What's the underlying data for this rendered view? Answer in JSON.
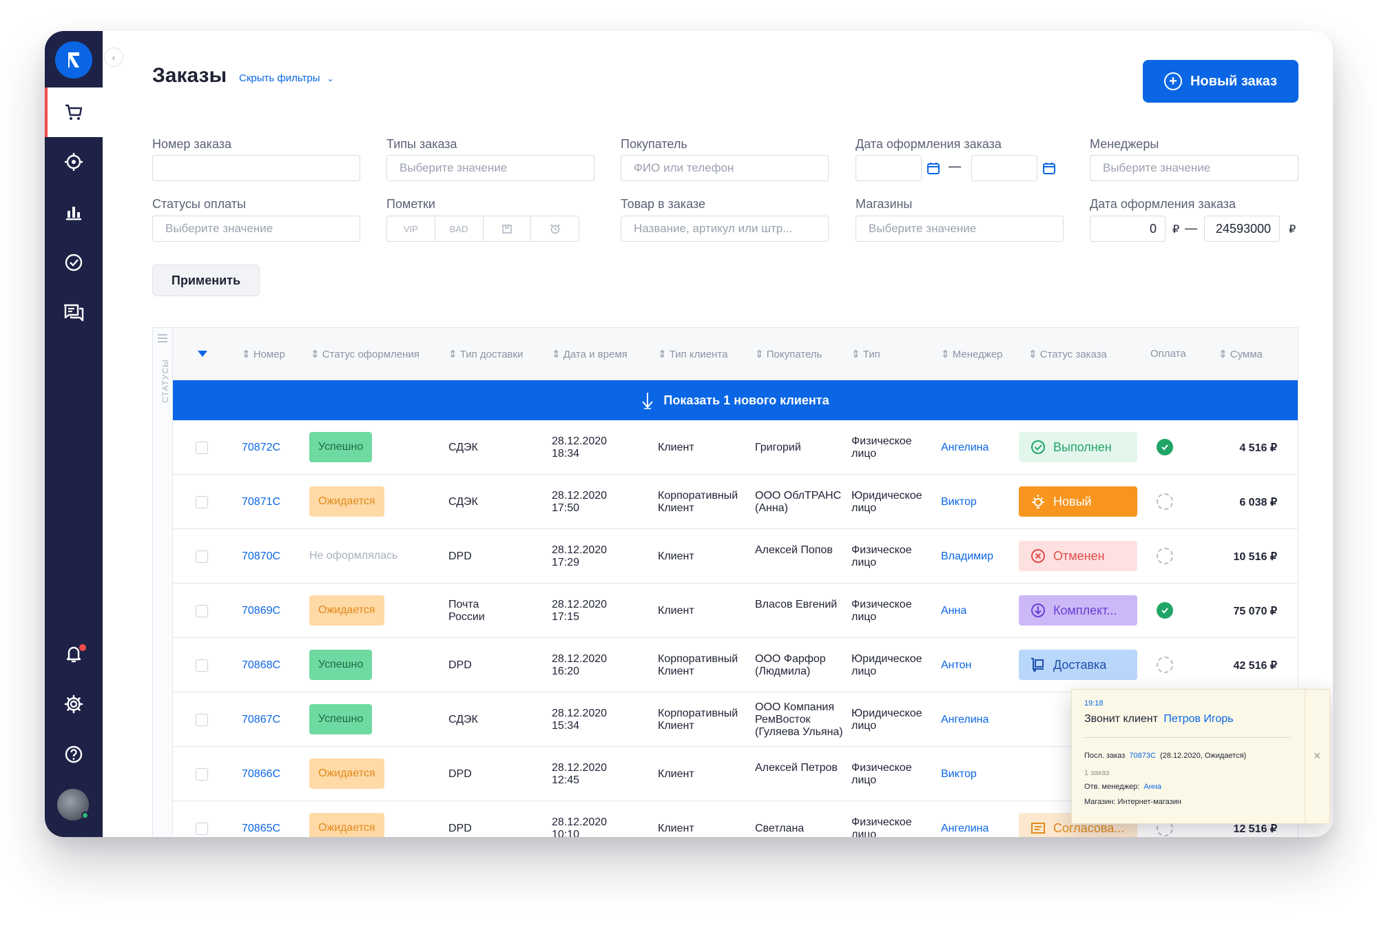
{
  "page": {
    "title": "Заказы",
    "hide_filters": "Скрыть фильтры",
    "new_order": "Новый заказ",
    "apply": "Применить"
  },
  "colors": {
    "sidebar": "#1e2247",
    "accent": "#0a66e4",
    "alert": "#f24a4a",
    "success": "#21a567"
  },
  "sidebar": {
    "items": [
      {
        "name": "orders",
        "icon": "cart-icon",
        "active": true
      },
      {
        "name": "tracking",
        "icon": "target-icon"
      },
      {
        "name": "analytics",
        "icon": "bar-chart-icon"
      },
      {
        "name": "tasks",
        "icon": "check-circle-icon"
      },
      {
        "name": "chats",
        "icon": "chat-icon"
      }
    ],
    "bottom": [
      {
        "name": "notifications",
        "icon": "bell-icon"
      },
      {
        "name": "settings",
        "icon": "gear-icon"
      },
      {
        "name": "help",
        "icon": "question-icon"
      }
    ]
  },
  "filters": {
    "order_number": {
      "label": "Номер заказа",
      "placeholder": ""
    },
    "order_types": {
      "label": "Типы заказа",
      "placeholder": "Выберите значение"
    },
    "buyer": {
      "label": "Покупатель",
      "placeholder": "ФИО или телефон"
    },
    "order_date": {
      "label": "Дата оформления заказа"
    },
    "managers": {
      "label": "Менеджеры",
      "placeholder": "Выберите значение"
    },
    "pay_status": {
      "label": "Статусы оплаты",
      "placeholder": "Выберите значение"
    },
    "marks": {
      "label": "Пометки",
      "tags": [
        "VIP",
        "BAD",
        "",
        ""
      ]
    },
    "product": {
      "label": "Товар в заказе",
      "placeholder": "Название, артикул или штр..."
    },
    "shops": {
      "label": "Магазины",
      "placeholder": "Выберите значение"
    },
    "amount": {
      "label": "Дата оформления заказа",
      "from": "0",
      "to": "24593000",
      "currency": "₽"
    }
  },
  "table": {
    "side_label": "СТАТУСЫ",
    "headers": [
      "Номер",
      "Статус оформления",
      "Тип доставки",
      "Дата и время",
      "Тип клиента",
      "Покупатель",
      "Тип",
      "Менеджер",
      "Статус заказа",
      "Оплата",
      "Сумма"
    ],
    "new_client_bar": "Показать 1 нового клиента",
    "rows": [
      {
        "num": "70872C",
        "reg": "Успешно",
        "reg_kind": "success",
        "delivery": "СДЭК",
        "date": "28.12.2020",
        "time": "18:34",
        "ctype": "Клиент",
        "buyer": "Григорий",
        "type": "Физическое лицо",
        "manager": "Ангелина",
        "status": "Выполнен",
        "status_kind": "done",
        "paid": true,
        "sum": "4 516 ₽"
      },
      {
        "num": "70871C",
        "reg": "Ожидается",
        "reg_kind": "wait",
        "delivery": "СДЭК",
        "date": "28.12.2020",
        "time": "17:50",
        "ctype": "Корпоративный Клиент",
        "buyer": "ООО ОблТРАНС (Анна)",
        "type": "Юридическое лицо",
        "manager": "Виктор",
        "status": "Новый",
        "status_kind": "new",
        "paid": false,
        "sum": "6 038 ₽"
      },
      {
        "num": "70870C",
        "reg": "Не оформлялась",
        "reg_kind": "none",
        "delivery": "DPD",
        "date": "28.12.2020",
        "time": "17:29",
        "ctype": "Клиент",
        "buyer": "Алексей Попов",
        "type": "Физическое лицо",
        "manager": "Владимир",
        "status": "Отменен",
        "status_kind": "cancel",
        "paid": false,
        "sum": "10 516 ₽"
      },
      {
        "num": "70869C",
        "reg": "Ожидается",
        "reg_kind": "wait",
        "delivery": "Почта России",
        "date": "28.12.2020",
        "time": "17:15",
        "ctype": "Клиент",
        "buyer": "Власов Евгений",
        "type": "Физическое лицо",
        "manager": "Анна",
        "status": "Комплект...",
        "status_kind": "assembly",
        "paid": true,
        "sum": "75 070 ₽"
      },
      {
        "num": "70868C",
        "reg": "Успешно",
        "reg_kind": "success",
        "delivery": "DPD",
        "date": "28.12.2020",
        "time": "16:20",
        "ctype": "Корпоративный Клиент",
        "buyer": "ООО Фарфор (Людмила)",
        "type": "Юридическое лицо",
        "manager": "Антон",
        "status": "Доставка",
        "status_kind": "delivery",
        "paid": false,
        "sum": "42 516 ₽"
      },
      {
        "num": "70867C",
        "reg": "Успешно",
        "reg_kind": "success",
        "delivery": "СДЭК",
        "date": "28.12.2020",
        "time": "15:34",
        "ctype": "Корпоративный Клиент",
        "buyer": "ООО Компания РемВосток (Гуляева Ульяна)",
        "type": "Юридическое лицо",
        "manager": "Ангелина",
        "status": "",
        "status_kind": "hidden",
        "paid": false,
        "sum": ""
      },
      {
        "num": "70866C",
        "reg": "Ожидается",
        "reg_kind": "wait",
        "delivery": "DPD",
        "date": "28.12.2020",
        "time": "12:45",
        "ctype": "Клиент",
        "buyer": "Алексей Петров",
        "type": "Физическое лицо",
        "manager": "Виктор",
        "status": "",
        "status_kind": "hidden",
        "paid": false,
        "sum": ""
      },
      {
        "num": "70865C",
        "reg": "Ожидается",
        "reg_kind": "wait",
        "delivery": "DPD",
        "date": "28.12.2020",
        "time": "10:10",
        "ctype": "Клиент",
        "buyer": "Светлана",
        "type": "Физическое лицо",
        "manager": "Ангелина",
        "status": "Согласова...",
        "status_kind": "agree",
        "paid": false,
        "sum": "12 516 ₽"
      }
    ]
  },
  "popup": {
    "time": "19:18",
    "title_prefix": "Звонит клиент",
    "client": "Петров Игорь",
    "last_order_prefix": "Посл. заказ",
    "last_order_num": "70873C",
    "last_order_suffix": "(28.12.2020, Ожидается)",
    "orders_count": "1 заказ",
    "manager_prefix": "Отв. менеджер:",
    "manager": "Анна",
    "shop": "Магазин: Интернет-магазин"
  }
}
